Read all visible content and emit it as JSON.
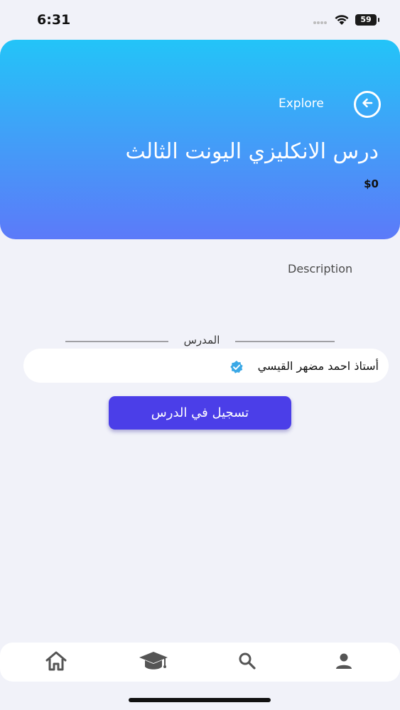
{
  "status_bar": {
    "time": "6:31",
    "battery": "59",
    "icons": [
      "signal-icon",
      "wifi-icon",
      "battery-icon"
    ]
  },
  "header": {
    "back_icon": "arrow-left-circle-icon",
    "explore_label": "Explore",
    "course_title": "درس الانكليزي اليونت الثالث",
    "price": "$0",
    "gradient_colors": [
      "#23c4f8",
      "#5c7af9"
    ]
  },
  "description": {
    "label": "Description"
  },
  "teacher": {
    "heading": "المدرس",
    "name": "أستاذ احمد مضهر القيسي",
    "verified_icon": "verified-badge-icon",
    "verified_color": "#3aa8e6"
  },
  "enroll": {
    "label": "تسجيل في الدرس",
    "color": "#4b3ee8"
  },
  "bottom_nav": {
    "items": [
      {
        "icon": "home-icon"
      },
      {
        "icon": "graduation-cap-icon"
      },
      {
        "icon": "search-icon"
      },
      {
        "icon": "person-icon"
      }
    ]
  }
}
